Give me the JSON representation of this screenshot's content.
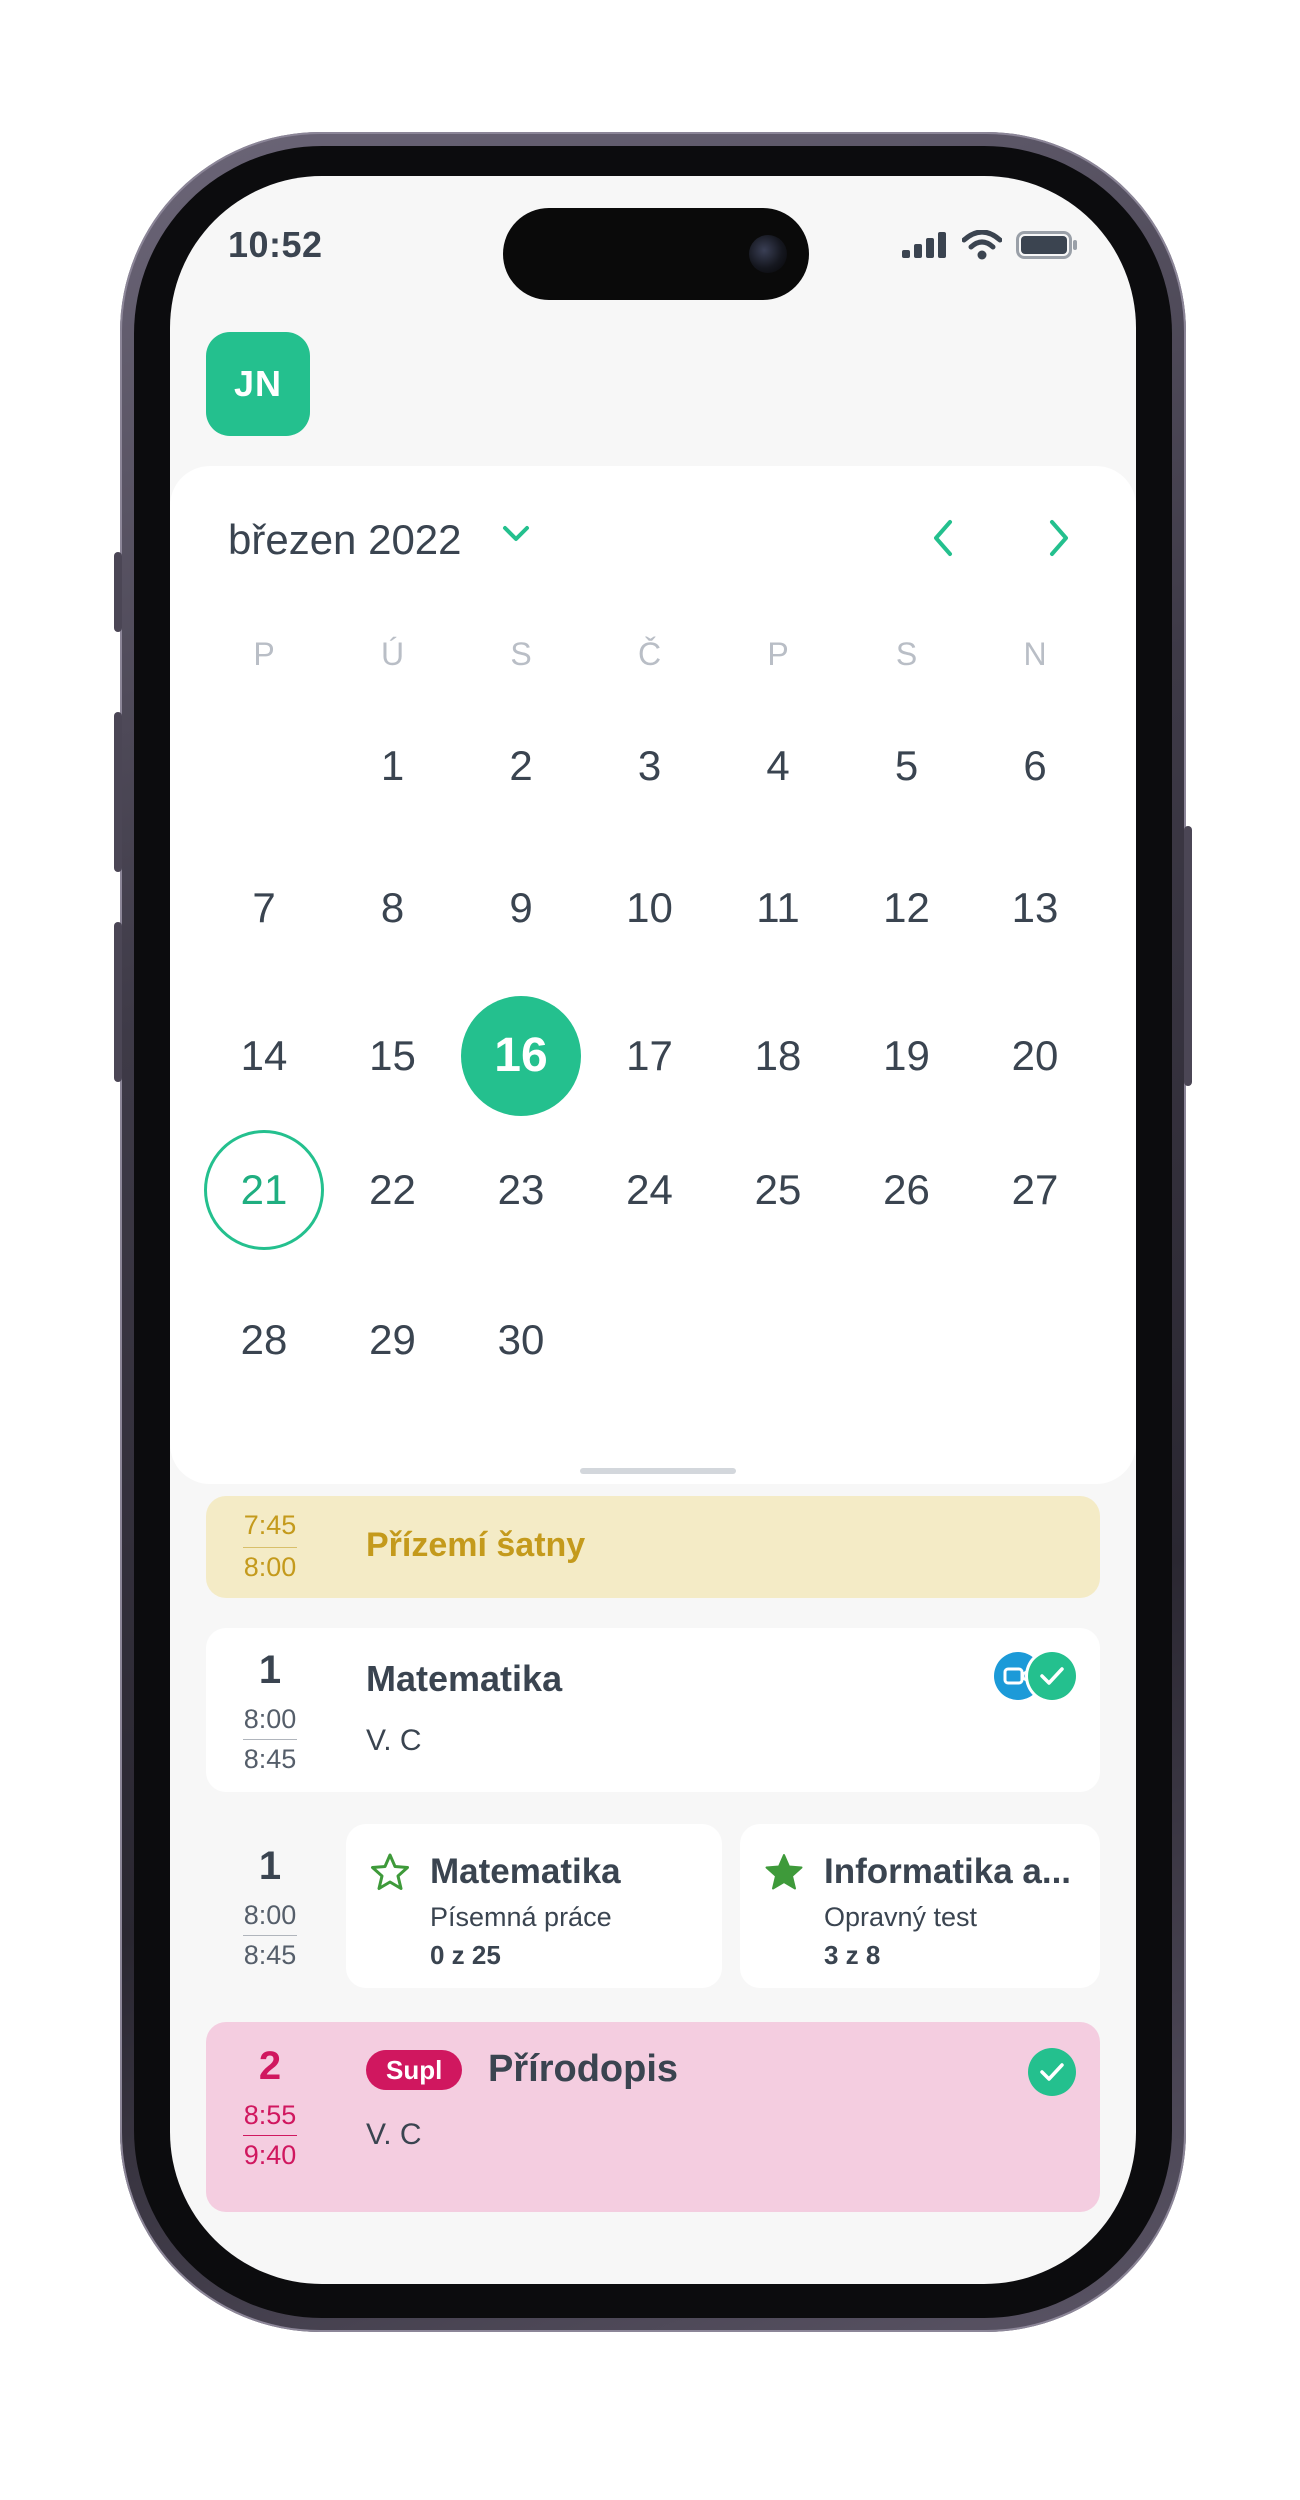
{
  "status_bar": {
    "time": "10:52",
    "icons": [
      "cellular-signal-icon",
      "wifi-icon",
      "battery-icon"
    ]
  },
  "user": {
    "initials": "JN"
  },
  "calendar": {
    "month_label": "březen 2022",
    "weekdays": [
      "P",
      "Ú",
      "S",
      "Č",
      "P",
      "S",
      "N"
    ],
    "weeks": [
      [
        "",
        "1",
        "2",
        "3",
        "4",
        "5",
        "6"
      ],
      [
        "7",
        "8",
        "9",
        "10",
        "11",
        "12",
        "13"
      ],
      [
        "14",
        "15",
        "16",
        "17",
        "18",
        "19",
        "20"
      ],
      [
        "21",
        "22",
        "23",
        "24",
        "25",
        "26",
        "27"
      ],
      [
        "28",
        "29",
        "30",
        "",
        "",
        "",
        ""
      ]
    ],
    "selected_day": "16",
    "today_day": "21"
  },
  "schedule": {
    "event_yellow": {
      "time_start": "7:45",
      "time_end": "8:00",
      "title": "Přízemí šatny"
    },
    "lesson1": {
      "number": "1",
      "time_start": "8:00",
      "time_end": "8:45",
      "title": "Matematika",
      "room": "V. C",
      "icons": [
        "video-icon",
        "check-icon"
      ]
    },
    "lesson1_tasks": {
      "number": "1",
      "time_start": "8:00",
      "time_end": "8:45",
      "tasks": [
        {
          "icon": "star-outline-icon",
          "title": "Matematika",
          "type": "Písemná práce",
          "progress": "0 z 25"
        },
        {
          "icon": "star-filled-icon",
          "title": "Informatika a...",
          "type": "Opravný test",
          "progress": "3 z 8"
        }
      ]
    },
    "lesson2": {
      "number": "2",
      "time_start": "8:55",
      "time_end": "9:40",
      "badge": "Supl",
      "title": "Přírodopis",
      "room": "V. C",
      "icons": [
        "check-icon"
      ]
    }
  },
  "colors": {
    "accent": "#24c08e",
    "yellow_bg": "#f4ebc6",
    "yellow_text": "#c49a1c",
    "pink_bg": "#f4cde0",
    "pink_text": "#d0175f",
    "video_blue": "#1c9ad8"
  }
}
